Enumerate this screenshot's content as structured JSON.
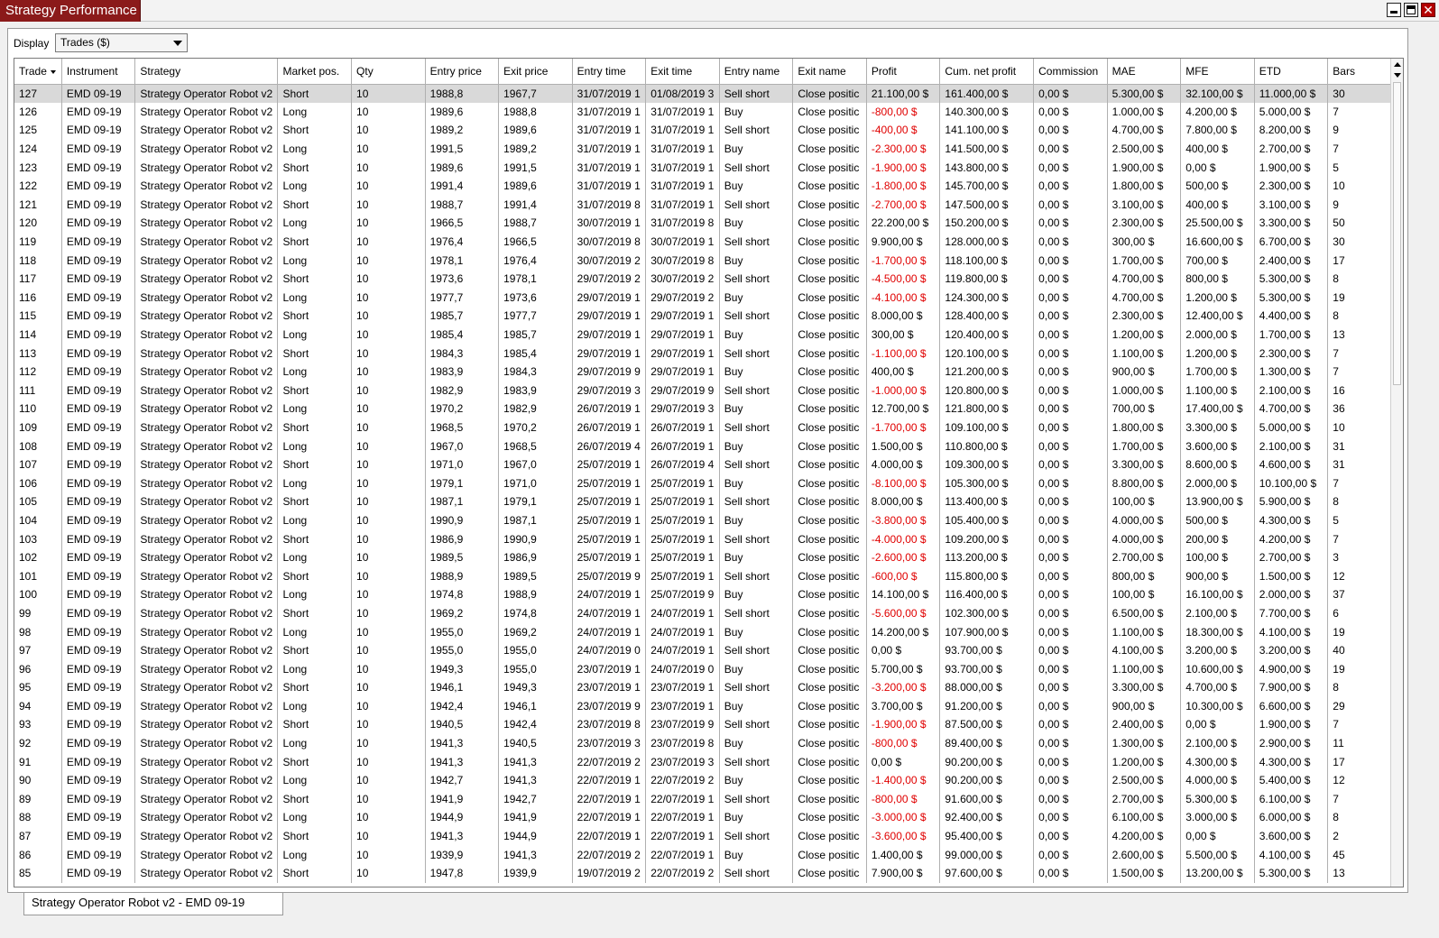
{
  "window": {
    "title": "Strategy Performance",
    "buttons": {
      "close_glyph": "✕"
    }
  },
  "toolbar": {
    "display_label": "Display",
    "display_value": "Trades ($)"
  },
  "table": {
    "columns": [
      "Trade",
      "Instrument",
      "Strategy",
      "Market pos.",
      "Qty",
      "Entry price",
      "Exit price",
      "Entry time",
      "Exit time",
      "Entry name",
      "Exit name",
      "Profit",
      "Cum. net profit",
      "Commission",
      "MAE",
      "MFE",
      "ETD",
      "Bars"
    ],
    "sort_column": "Trade",
    "selected_row": 0,
    "rows": [
      [
        "127",
        "EMD 09-19",
        "Strategy Operator Robot v2",
        "Short",
        "10",
        "1988,8",
        "1967,7",
        "31/07/2019 1",
        "01/08/2019 3",
        "Sell short",
        "Close positic",
        "21.100,00 $",
        "161.400,00 $",
        "0,00 $",
        "5.300,00 $",
        "32.100,00 $",
        "11.000,00 $",
        "30"
      ],
      [
        "126",
        "EMD 09-19",
        "Strategy Operator Robot v2",
        "Long",
        "10",
        "1989,6",
        "1988,8",
        "31/07/2019 1",
        "31/07/2019 1",
        "Buy",
        "Close positic",
        "-800,00 $",
        "140.300,00 $",
        "0,00 $",
        "1.000,00 $",
        "4.200,00 $",
        "5.000,00 $",
        "7"
      ],
      [
        "125",
        "EMD 09-19",
        "Strategy Operator Robot v2",
        "Short",
        "10",
        "1989,2",
        "1989,6",
        "31/07/2019 1",
        "31/07/2019 1",
        "Sell short",
        "Close positic",
        "-400,00 $",
        "141.100,00 $",
        "0,00 $",
        "4.700,00 $",
        "7.800,00 $",
        "8.200,00 $",
        "9"
      ],
      [
        "124",
        "EMD 09-19",
        "Strategy Operator Robot v2",
        "Long",
        "10",
        "1991,5",
        "1989,2",
        "31/07/2019 1",
        "31/07/2019 1",
        "Buy",
        "Close positic",
        "-2.300,00 $",
        "141.500,00 $",
        "0,00 $",
        "2.500,00 $",
        "400,00 $",
        "2.700,00 $",
        "7"
      ],
      [
        "123",
        "EMD 09-19",
        "Strategy Operator Robot v2",
        "Short",
        "10",
        "1989,6",
        "1991,5",
        "31/07/2019 1",
        "31/07/2019 1",
        "Sell short",
        "Close positic",
        "-1.900,00 $",
        "143.800,00 $",
        "0,00 $",
        "1.900,00 $",
        "0,00 $",
        "1.900,00 $",
        "5"
      ],
      [
        "122",
        "EMD 09-19",
        "Strategy Operator Robot v2",
        "Long",
        "10",
        "1991,4",
        "1989,6",
        "31/07/2019 1",
        "31/07/2019 1",
        "Buy",
        "Close positic",
        "-1.800,00 $",
        "145.700,00 $",
        "0,00 $",
        "1.800,00 $",
        "500,00 $",
        "2.300,00 $",
        "10"
      ],
      [
        "121",
        "EMD 09-19",
        "Strategy Operator Robot v2",
        "Short",
        "10",
        "1988,7",
        "1991,4",
        "31/07/2019 8",
        "31/07/2019 1",
        "Sell short",
        "Close positic",
        "-2.700,00 $",
        "147.500,00 $",
        "0,00 $",
        "3.100,00 $",
        "400,00 $",
        "3.100,00 $",
        "9"
      ],
      [
        "120",
        "EMD 09-19",
        "Strategy Operator Robot v2",
        "Long",
        "10",
        "1966,5",
        "1988,7",
        "30/07/2019 1",
        "31/07/2019 8",
        "Buy",
        "Close positic",
        "22.200,00 $",
        "150.200,00 $",
        "0,00 $",
        "2.300,00 $",
        "25.500,00 $",
        "3.300,00 $",
        "50"
      ],
      [
        "119",
        "EMD 09-19",
        "Strategy Operator Robot v2",
        "Short",
        "10",
        "1976,4",
        "1966,5",
        "30/07/2019 8",
        "30/07/2019 1",
        "Sell short",
        "Close positic",
        "9.900,00 $",
        "128.000,00 $",
        "0,00 $",
        "300,00 $",
        "16.600,00 $",
        "6.700,00 $",
        "30"
      ],
      [
        "118",
        "EMD 09-19",
        "Strategy Operator Robot v2",
        "Long",
        "10",
        "1978,1",
        "1976,4",
        "30/07/2019 2",
        "30/07/2019 8",
        "Buy",
        "Close positic",
        "-1.700,00 $",
        "118.100,00 $",
        "0,00 $",
        "1.700,00 $",
        "700,00 $",
        "2.400,00 $",
        "17"
      ],
      [
        "117",
        "EMD 09-19",
        "Strategy Operator Robot v2",
        "Short",
        "10",
        "1973,6",
        "1978,1",
        "29/07/2019 2",
        "30/07/2019 2",
        "Sell short",
        "Close positic",
        "-4.500,00 $",
        "119.800,00 $",
        "0,00 $",
        "4.700,00 $",
        "800,00 $",
        "5.300,00 $",
        "8"
      ],
      [
        "116",
        "EMD 09-19",
        "Strategy Operator Robot v2",
        "Long",
        "10",
        "1977,7",
        "1973,6",
        "29/07/2019 1",
        "29/07/2019 2",
        "Buy",
        "Close positic",
        "-4.100,00 $",
        "124.300,00 $",
        "0,00 $",
        "4.700,00 $",
        "1.200,00 $",
        "5.300,00 $",
        "19"
      ],
      [
        "115",
        "EMD 09-19",
        "Strategy Operator Robot v2",
        "Short",
        "10",
        "1985,7",
        "1977,7",
        "29/07/2019 1",
        "29/07/2019 1",
        "Sell short",
        "Close positic",
        "8.000,00 $",
        "128.400,00 $",
        "0,00 $",
        "2.300,00 $",
        "12.400,00 $",
        "4.400,00 $",
        "8"
      ],
      [
        "114",
        "EMD 09-19",
        "Strategy Operator Robot v2",
        "Long",
        "10",
        "1985,4",
        "1985,7",
        "29/07/2019 1",
        "29/07/2019 1",
        "Buy",
        "Close positic",
        "300,00 $",
        "120.400,00 $",
        "0,00 $",
        "1.200,00 $",
        "2.000,00 $",
        "1.700,00 $",
        "13"
      ],
      [
        "113",
        "EMD 09-19",
        "Strategy Operator Robot v2",
        "Short",
        "10",
        "1984,3",
        "1985,4",
        "29/07/2019 1",
        "29/07/2019 1",
        "Sell short",
        "Close positic",
        "-1.100,00 $",
        "120.100,00 $",
        "0,00 $",
        "1.100,00 $",
        "1.200,00 $",
        "2.300,00 $",
        "7"
      ],
      [
        "112",
        "EMD 09-19",
        "Strategy Operator Robot v2",
        "Long",
        "10",
        "1983,9",
        "1984,3",
        "29/07/2019 9",
        "29/07/2019 1",
        "Buy",
        "Close positic",
        "400,00 $",
        "121.200,00 $",
        "0,00 $",
        "900,00 $",
        "1.700,00 $",
        "1.300,00 $",
        "7"
      ],
      [
        "111",
        "EMD 09-19",
        "Strategy Operator Robot v2",
        "Short",
        "10",
        "1982,9",
        "1983,9",
        "29/07/2019 3",
        "29/07/2019 9",
        "Sell short",
        "Close positic",
        "-1.000,00 $",
        "120.800,00 $",
        "0,00 $",
        "1.000,00 $",
        "1.100,00 $",
        "2.100,00 $",
        "16"
      ],
      [
        "110",
        "EMD 09-19",
        "Strategy Operator Robot v2",
        "Long",
        "10",
        "1970,2",
        "1982,9",
        "26/07/2019 1",
        "29/07/2019 3",
        "Buy",
        "Close positic",
        "12.700,00 $",
        "121.800,00 $",
        "0,00 $",
        "700,00 $",
        "17.400,00 $",
        "4.700,00 $",
        "36"
      ],
      [
        "109",
        "EMD 09-19",
        "Strategy Operator Robot v2",
        "Short",
        "10",
        "1968,5",
        "1970,2",
        "26/07/2019 1",
        "26/07/2019 1",
        "Sell short",
        "Close positic",
        "-1.700,00 $",
        "109.100,00 $",
        "0,00 $",
        "1.800,00 $",
        "3.300,00 $",
        "5.000,00 $",
        "10"
      ],
      [
        "108",
        "EMD 09-19",
        "Strategy Operator Robot v2",
        "Long",
        "10",
        "1967,0",
        "1968,5",
        "26/07/2019 4",
        "26/07/2019 1",
        "Buy",
        "Close positic",
        "1.500,00 $",
        "110.800,00 $",
        "0,00 $",
        "1.700,00 $",
        "3.600,00 $",
        "2.100,00 $",
        "31"
      ],
      [
        "107",
        "EMD 09-19",
        "Strategy Operator Robot v2",
        "Short",
        "10",
        "1971,0",
        "1967,0",
        "25/07/2019 1",
        "26/07/2019 4",
        "Sell short",
        "Close positic",
        "4.000,00 $",
        "109.300,00 $",
        "0,00 $",
        "3.300,00 $",
        "8.600,00 $",
        "4.600,00 $",
        "31"
      ],
      [
        "106",
        "EMD 09-19",
        "Strategy Operator Robot v2",
        "Long",
        "10",
        "1979,1",
        "1971,0",
        "25/07/2019 1",
        "25/07/2019 1",
        "Buy",
        "Close positic",
        "-8.100,00 $",
        "105.300,00 $",
        "0,00 $",
        "8.800,00 $",
        "2.000,00 $",
        "10.100,00 $",
        "7"
      ],
      [
        "105",
        "EMD 09-19",
        "Strategy Operator Robot v2",
        "Short",
        "10",
        "1987,1",
        "1979,1",
        "25/07/2019 1",
        "25/07/2019 1",
        "Sell short",
        "Close positic",
        "8.000,00 $",
        "113.400,00 $",
        "0,00 $",
        "100,00 $",
        "13.900,00 $",
        "5.900,00 $",
        "8"
      ],
      [
        "104",
        "EMD 09-19",
        "Strategy Operator Robot v2",
        "Long",
        "10",
        "1990,9",
        "1987,1",
        "25/07/2019 1",
        "25/07/2019 1",
        "Buy",
        "Close positic",
        "-3.800,00 $",
        "105.400,00 $",
        "0,00 $",
        "4.000,00 $",
        "500,00 $",
        "4.300,00 $",
        "5"
      ],
      [
        "103",
        "EMD 09-19",
        "Strategy Operator Robot v2",
        "Short",
        "10",
        "1986,9",
        "1990,9",
        "25/07/2019 1",
        "25/07/2019 1",
        "Sell short",
        "Close positic",
        "-4.000,00 $",
        "109.200,00 $",
        "0,00 $",
        "4.000,00 $",
        "200,00 $",
        "4.200,00 $",
        "7"
      ],
      [
        "102",
        "EMD 09-19",
        "Strategy Operator Robot v2",
        "Long",
        "10",
        "1989,5",
        "1986,9",
        "25/07/2019 1",
        "25/07/2019 1",
        "Buy",
        "Close positic",
        "-2.600,00 $",
        "113.200,00 $",
        "0,00 $",
        "2.700,00 $",
        "100,00 $",
        "2.700,00 $",
        "3"
      ],
      [
        "101",
        "EMD 09-19",
        "Strategy Operator Robot v2",
        "Short",
        "10",
        "1988,9",
        "1989,5",
        "25/07/2019 9",
        "25/07/2019 1",
        "Sell short",
        "Close positic",
        "-600,00 $",
        "115.800,00 $",
        "0,00 $",
        "800,00 $",
        "900,00 $",
        "1.500,00 $",
        "12"
      ],
      [
        "100",
        "EMD 09-19",
        "Strategy Operator Robot v2",
        "Long",
        "10",
        "1974,8",
        "1988,9",
        "24/07/2019 1",
        "25/07/2019 9",
        "Buy",
        "Close positic",
        "14.100,00 $",
        "116.400,00 $",
        "0,00 $",
        "100,00 $",
        "16.100,00 $",
        "2.000,00 $",
        "37"
      ],
      [
        "99",
        "EMD 09-19",
        "Strategy Operator Robot v2",
        "Short",
        "10",
        "1969,2",
        "1974,8",
        "24/07/2019 1",
        "24/07/2019 1",
        "Sell short",
        "Close positic",
        "-5.600,00 $",
        "102.300,00 $",
        "0,00 $",
        "6.500,00 $",
        "2.100,00 $",
        "7.700,00 $",
        "6"
      ],
      [
        "98",
        "EMD 09-19",
        "Strategy Operator Robot v2",
        "Long",
        "10",
        "1955,0",
        "1969,2",
        "24/07/2019 1",
        "24/07/2019 1",
        "Buy",
        "Close positic",
        "14.200,00 $",
        "107.900,00 $",
        "0,00 $",
        "1.100,00 $",
        "18.300,00 $",
        "4.100,00 $",
        "19"
      ],
      [
        "97",
        "EMD 09-19",
        "Strategy Operator Robot v2",
        "Short",
        "10",
        "1955,0",
        "1955,0",
        "24/07/2019 0",
        "24/07/2019 1",
        "Sell short",
        "Close positic",
        "0,00 $",
        "93.700,00 $",
        "0,00 $",
        "4.100,00 $",
        "3.200,00 $",
        "3.200,00 $",
        "40"
      ],
      [
        "96",
        "EMD 09-19",
        "Strategy Operator Robot v2",
        "Long",
        "10",
        "1949,3",
        "1955,0",
        "23/07/2019 1",
        "24/07/2019 0",
        "Buy",
        "Close positic",
        "5.700,00 $",
        "93.700,00 $",
        "0,00 $",
        "1.100,00 $",
        "10.600,00 $",
        "4.900,00 $",
        "19"
      ],
      [
        "95",
        "EMD 09-19",
        "Strategy Operator Robot v2",
        "Short",
        "10",
        "1946,1",
        "1949,3",
        "23/07/2019 1",
        "23/07/2019 1",
        "Sell short",
        "Close positic",
        "-3.200,00 $",
        "88.000,00 $",
        "0,00 $",
        "3.300,00 $",
        "4.700,00 $",
        "7.900,00 $",
        "8"
      ],
      [
        "94",
        "EMD 09-19",
        "Strategy Operator Robot v2",
        "Long",
        "10",
        "1942,4",
        "1946,1",
        "23/07/2019 9",
        "23/07/2019 1",
        "Buy",
        "Close positic",
        "3.700,00 $",
        "91.200,00 $",
        "0,00 $",
        "900,00 $",
        "10.300,00 $",
        "6.600,00 $",
        "29"
      ],
      [
        "93",
        "EMD 09-19",
        "Strategy Operator Robot v2",
        "Short",
        "10",
        "1940,5",
        "1942,4",
        "23/07/2019 8",
        "23/07/2019 9",
        "Sell short",
        "Close positic",
        "-1.900,00 $",
        "87.500,00 $",
        "0,00 $",
        "2.400,00 $",
        "0,00 $",
        "1.900,00 $",
        "7"
      ],
      [
        "92",
        "EMD 09-19",
        "Strategy Operator Robot v2",
        "Long",
        "10",
        "1941,3",
        "1940,5",
        "23/07/2019 3",
        "23/07/2019 8",
        "Buy",
        "Close positic",
        "-800,00 $",
        "89.400,00 $",
        "0,00 $",
        "1.300,00 $",
        "2.100,00 $",
        "2.900,00 $",
        "11"
      ],
      [
        "91",
        "EMD 09-19",
        "Strategy Operator Robot v2",
        "Short",
        "10",
        "1941,3",
        "1941,3",
        "22/07/2019 2",
        "23/07/2019 3",
        "Sell short",
        "Close positic",
        "0,00 $",
        "90.200,00 $",
        "0,00 $",
        "1.200,00 $",
        "4.300,00 $",
        "4.300,00 $",
        "17"
      ],
      [
        "90",
        "EMD 09-19",
        "Strategy Operator Robot v2",
        "Long",
        "10",
        "1942,7",
        "1941,3",
        "22/07/2019 1",
        "22/07/2019 2",
        "Buy",
        "Close positic",
        "-1.400,00 $",
        "90.200,00 $",
        "0,00 $",
        "2.500,00 $",
        "4.000,00 $",
        "5.400,00 $",
        "12"
      ],
      [
        "89",
        "EMD 09-19",
        "Strategy Operator Robot v2",
        "Short",
        "10",
        "1941,9",
        "1942,7",
        "22/07/2019 1",
        "22/07/2019 1",
        "Sell short",
        "Close positic",
        "-800,00 $",
        "91.600,00 $",
        "0,00 $",
        "2.700,00 $",
        "5.300,00 $",
        "6.100,00 $",
        "7"
      ],
      [
        "88",
        "EMD 09-19",
        "Strategy Operator Robot v2",
        "Long",
        "10",
        "1944,9",
        "1941,9",
        "22/07/2019 1",
        "22/07/2019 1",
        "Buy",
        "Close positic",
        "-3.000,00 $",
        "92.400,00 $",
        "0,00 $",
        "6.100,00 $",
        "3.000,00 $",
        "6.000,00 $",
        "8"
      ],
      [
        "87",
        "EMD 09-19",
        "Strategy Operator Robot v2",
        "Short",
        "10",
        "1941,3",
        "1944,9",
        "22/07/2019 1",
        "22/07/2019 1",
        "Sell short",
        "Close positic",
        "-3.600,00 $",
        "95.400,00 $",
        "0,00 $",
        "4.200,00 $",
        "0,00 $",
        "3.600,00 $",
        "2"
      ],
      [
        "86",
        "EMD 09-19",
        "Strategy Operator Robot v2",
        "Long",
        "10",
        "1939,9",
        "1941,3",
        "22/07/2019 2",
        "22/07/2019 1",
        "Buy",
        "Close positic",
        "1.400,00 $",
        "99.000,00 $",
        "0,00 $",
        "2.600,00 $",
        "5.500,00 $",
        "4.100,00 $",
        "45"
      ],
      [
        "85",
        "EMD 09-19",
        "Strategy Operator Robot v2",
        "Short",
        "10",
        "1947,8",
        "1939,9",
        "19/07/2019 2",
        "22/07/2019 2",
        "Sell short",
        "Close positic",
        "7.900,00 $",
        "97.600,00 $",
        "0,00 $",
        "1.500,00 $",
        "13.200,00 $",
        "5.300,00 $",
        "13"
      ]
    ]
  },
  "bottom_tab": {
    "label": "Strategy Operator Robot v2 - EMD 09-19"
  },
  "colors": {
    "title_tab_bg": "#8b1a1a",
    "negative_profit": "#e00000",
    "selected_row_bg": "#d9d9d9"
  }
}
